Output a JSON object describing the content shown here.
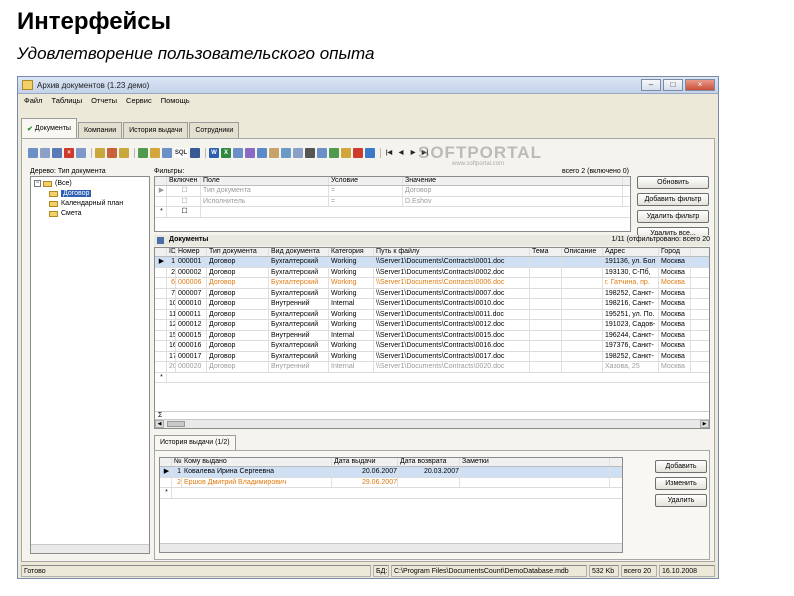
{
  "slide": {
    "title": "Интерфейсы",
    "subtitle": "Удовлетворение пользовательского опыта"
  },
  "window": {
    "title": "Архив документов (1.23 демо)",
    "menu": [
      "Файл",
      "Таблицы",
      "Отчеты",
      "Сервис",
      "Помощь"
    ],
    "tabs": [
      "Документы",
      "Компании",
      "История выдачи",
      "Сотрудники"
    ]
  },
  "watermark": {
    "text": "SOFTPORTAL",
    "url": "www.softportal.com"
  },
  "tree": {
    "label": "Дерево: Тип документа",
    "root": "(Все)",
    "items": [
      "Договор",
      "Календарный план",
      "Смета"
    ]
  },
  "filter": {
    "label": "Фильтры:",
    "count": "всего 2 (включено 0)",
    "columns": [
      "Включен",
      "Поле",
      "Условие",
      "Значение"
    ],
    "rows": [
      {
        "field": "Тип документа",
        "condition": "=",
        "value": "Договор"
      },
      {
        "field": "Исполнитель",
        "condition": "=",
        "value": "D.Eshov"
      }
    ],
    "buttons": [
      "Обновить",
      "Добавить фильтр",
      "Удалить фильтр",
      "Удалить все..."
    ]
  },
  "documents": {
    "title": "Документы",
    "count": "1/11 (отфильтровано: всего 20",
    "sum_marker": "Σ",
    "columns": [
      "ID",
      "Номер",
      "Тип документа",
      "Вид документа",
      "Категория",
      "Путь к файлу",
      "Тема",
      "Описание",
      "Адрес",
      "Город"
    ],
    "rows": [
      {
        "id": "1",
        "num": "000001",
        "type": "Договор",
        "kind": "Бухгалтерский",
        "cat": "Working",
        "path": "\\\\Server1\\Documents\\Contracts\\0001.doc",
        "topic": "",
        "desc": "",
        "addr": "191136, ул. Бол",
        "city": "Москва",
        "style": "selected"
      },
      {
        "id": "2",
        "num": "000002",
        "type": "Договор",
        "kind": "Бухгалтерский",
        "cat": "Working",
        "path": "\\\\Server1\\Documents\\Contracts\\0002.doc",
        "topic": "",
        "desc": "",
        "addr": "193130, С-Пб,",
        "city": "Москва",
        "style": ""
      },
      {
        "id": "6",
        "num": "000006",
        "type": "Договор",
        "kind": "Бухгалтерский",
        "cat": "Working",
        "path": "\\\\Server1\\Documents\\Contracts\\0006.doc",
        "topic": "",
        "desc": "",
        "addr": "г. Гатчина, пр.",
        "city": "Москва",
        "style": "orange"
      },
      {
        "id": "7",
        "num": "000007",
        "type": "Договор",
        "kind": "Бухгалтерский",
        "cat": "Working",
        "path": "\\\\Server1\\Documents\\Contracts\\0007.doc",
        "topic": "",
        "desc": "",
        "addr": "198252, Санкт-",
        "city": "Москва",
        "style": ""
      },
      {
        "id": "10",
        "num": "000010",
        "type": "Договор",
        "kind": "Внутренний",
        "cat": "Internal",
        "path": "\\\\Server1\\Documents\\Contracts\\0010.doc",
        "topic": "",
        "desc": "",
        "addr": "198216, Санкт-",
        "city": "Москва",
        "style": ""
      },
      {
        "id": "11",
        "num": "000011",
        "type": "Договор",
        "kind": "Бухгалтерский",
        "cat": "Working",
        "path": "\\\\Server1\\Documents\\Contracts\\0011.doc",
        "topic": "",
        "desc": "",
        "addr": "195251, ул. По.",
        "city": "Москва",
        "style": ""
      },
      {
        "id": "12",
        "num": "000012",
        "type": "Договор",
        "kind": "Бухгалтерский",
        "cat": "Working",
        "path": "\\\\Server1\\Documents\\Contracts\\0012.doc",
        "topic": "",
        "desc": "",
        "addr": "191023, Садов-",
        "city": "Москва",
        "style": ""
      },
      {
        "id": "15",
        "num": "000015",
        "type": "Договор",
        "kind": "Внутренний",
        "cat": "Internal",
        "path": "\\\\Server1\\Documents\\Contracts\\0015.doc",
        "topic": "",
        "desc": "",
        "addr": "196244, Санкт-",
        "city": "Москва",
        "style": ""
      },
      {
        "id": "16",
        "num": "000016",
        "type": "Договор",
        "kind": "Бухгалтерский",
        "cat": "Working",
        "path": "\\\\Server1\\Documents\\Contracts\\0016.doc",
        "topic": "",
        "desc": "",
        "addr": "197376, Санкт-",
        "city": "Москва",
        "style": ""
      },
      {
        "id": "17",
        "num": "000017",
        "type": "Договор",
        "kind": "Бухгалтерский",
        "cat": "Working",
        "path": "\\\\Server1\\Documents\\Contracts\\0017.doc",
        "topic": "",
        "desc": "",
        "addr": "198252, Санкт-",
        "city": "Москва",
        "style": ""
      },
      {
        "id": "20",
        "num": "000020",
        "type": "Договор",
        "kind": "Внутренний",
        "cat": "Internal",
        "path": "\\\\Server1\\Documents\\Contracts\\0020.doc",
        "topic": "",
        "desc": "",
        "addr": "Хазова, 25",
        "city": "Москва",
        "style": "gray"
      }
    ]
  },
  "history": {
    "tab": "История выдачи (1/2)",
    "columns": [
      "№",
      "Кому выдано",
      "Дата выдачи",
      "Дата возврата",
      "Заметки"
    ],
    "rows": [
      {
        "n": "1",
        "who": "Ковалева Ирина Сергеевна",
        "issued": "20.06.2007",
        "returned": "20.03.2007",
        "notes": "",
        "style": "selected"
      },
      {
        "n": "2",
        "who": "Ершов Дмитрий Владимирович",
        "issued": "29.06.2007",
        "returned": "",
        "notes": "",
        "style": "orange"
      }
    ],
    "buttons": [
      "Добавить",
      "Изменить",
      "Удалить"
    ]
  },
  "status": {
    "ready": "Готово",
    "db_label": "БД:",
    "db_path": "C:\\Program Files\\DocumentsCount\\DemoDatabase.mdb",
    "size": "532 Kb",
    "total": "всего 20",
    "date": "16.10.2008"
  }
}
